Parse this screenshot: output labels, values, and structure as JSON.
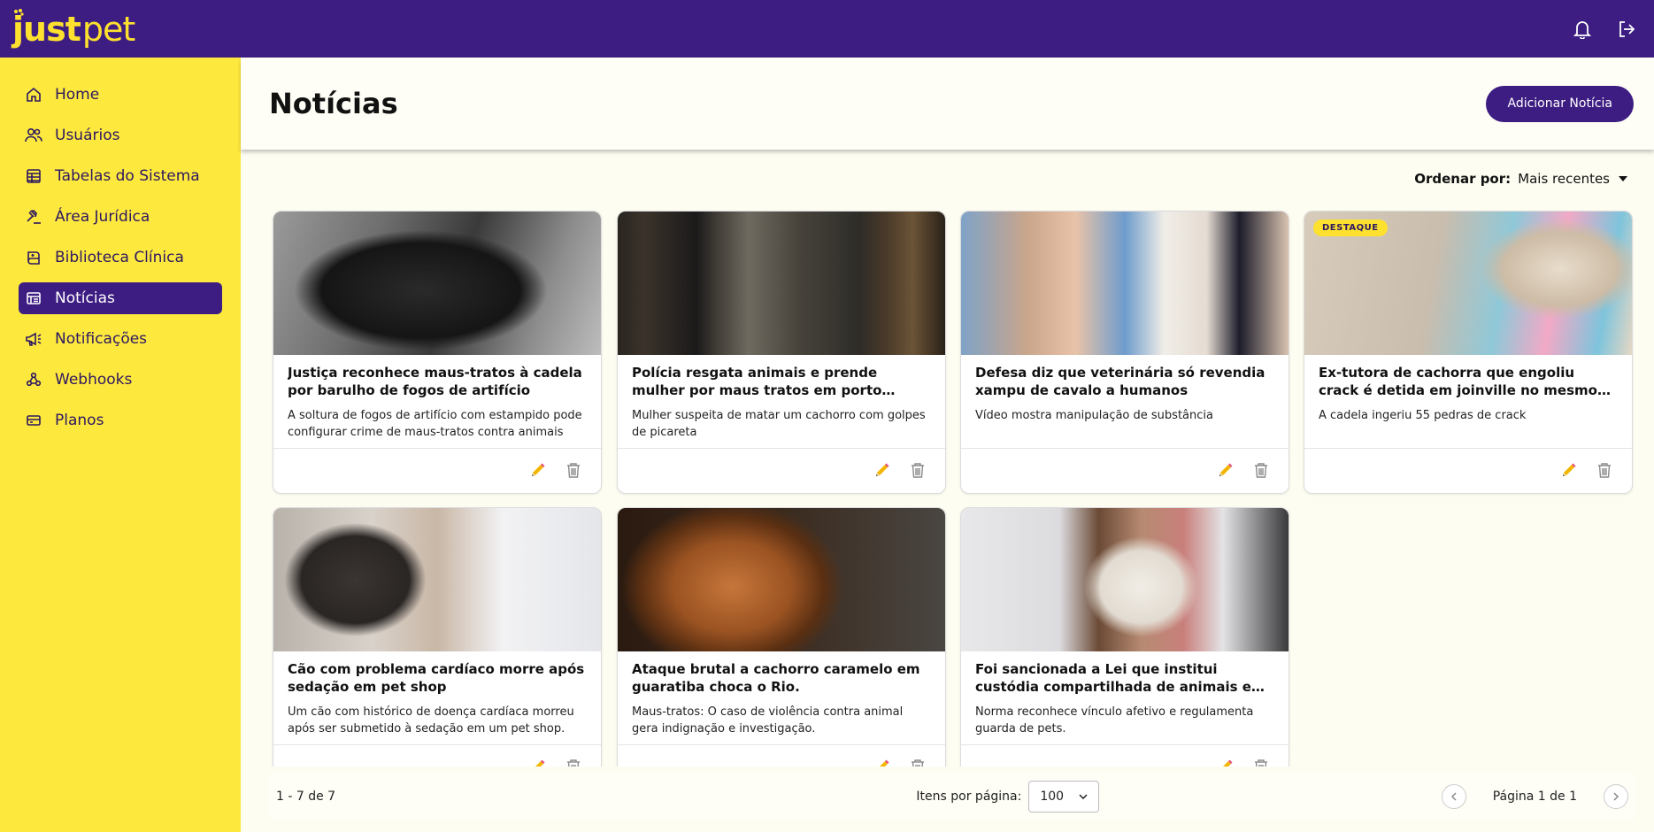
{
  "app": {
    "logo_just": "just",
    "logo_pet": "pet",
    "brand_color": "#3d1d82",
    "accent_color": "#fde93e"
  },
  "header": {
    "icons": [
      "bell-icon",
      "logout-icon"
    ]
  },
  "sidebar": {
    "items": [
      {
        "label": "Home",
        "icon": "home-icon",
        "active": false
      },
      {
        "label": "Usuários",
        "icon": "users-icon",
        "active": false
      },
      {
        "label": "Tabelas do Sistema",
        "icon": "table-icon",
        "active": false
      },
      {
        "label": "Área Jurídica",
        "icon": "gavel-icon",
        "active": false
      },
      {
        "label": "Biblioteca Clínica",
        "icon": "book-icon",
        "active": false
      },
      {
        "label": "Notícias",
        "icon": "news-icon",
        "active": true
      },
      {
        "label": "Notificações",
        "icon": "megaphone-icon",
        "active": false
      },
      {
        "label": "Webhooks",
        "icon": "webhook-icon",
        "active": false
      },
      {
        "label": "Planos",
        "icon": "card-icon",
        "active": false
      }
    ]
  },
  "page": {
    "title": "Notícias",
    "add_button": "Adicionar Notícia"
  },
  "sort": {
    "label": "Ordenar por:",
    "value": "Mais recentes"
  },
  "cards": [
    {
      "title": "Justiça reconhece maus-tratos à cadela por barulho de fogos de artifício",
      "description": "A soltura de fogos de artifício com estampido pode configurar crime de maus-tratos contra animais",
      "badge": ""
    },
    {
      "title": "Polícia resgata animais e prende mulher por maus tratos em porto alegre",
      "description": "Mulher suspeita de matar um cachorro com golpes de picareta",
      "badge": ""
    },
    {
      "title": "Defesa diz que veterinária só revendia xampu de cavalo a humanos",
      "description": "Vídeo mostra manipulação de substância",
      "badge": ""
    },
    {
      "title": "Ex-tutora de cachorra que engoliu crack é detida em joinville no mesmo dia em que...",
      "description": "A cadela ingeriu 55 pedras de crack",
      "badge": "DESTAQUE"
    },
    {
      "title": "Cão com problema cardíaco morre após sedação em pet shop",
      "description": "Um cão com histórico de doença cardíaca morreu após ser submetido à sedação em um pet shop.",
      "badge": ""
    },
    {
      "title": "Ataque brutal a cachorro caramelo em guaratiba choca o Rio.",
      "description": "Maus-tratos: O caso de violência contra animal gera indignação e investigação.",
      "badge": ""
    },
    {
      "title": "Foi sancionada a Lei que institui custódia compartilhada de animais em caso de...",
      "description": "Norma reconhece vínculo afetivo e regulamenta guarda de pets.",
      "badge": ""
    }
  ],
  "pagination": {
    "range": "1 - 7 de 7",
    "per_page_label": "Itens por página:",
    "per_page_value": "100",
    "page_label": "Página 1 de 1"
  }
}
